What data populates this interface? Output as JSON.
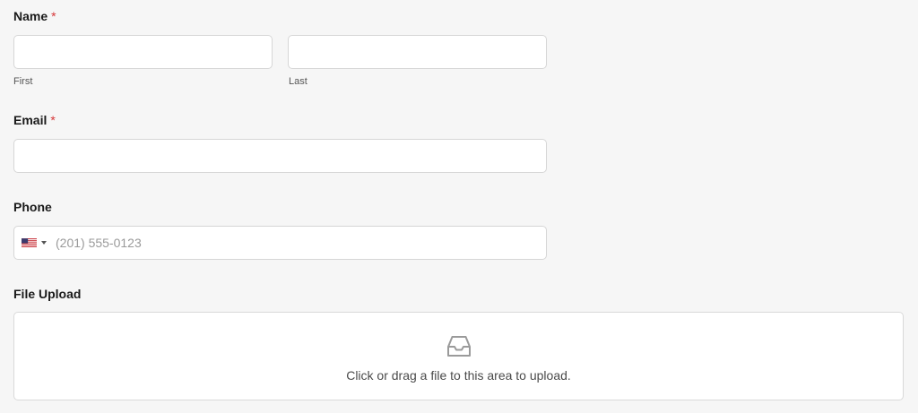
{
  "name": {
    "label": "Name",
    "required_mark": "*",
    "first": {
      "value": "",
      "sublabel": "First"
    },
    "last": {
      "value": "",
      "sublabel": "Last"
    }
  },
  "email": {
    "label": "Email",
    "required_mark": "*",
    "value": ""
  },
  "phone": {
    "label": "Phone",
    "country_icon": "us-flag-icon",
    "placeholder": "(201) 555-0123",
    "value": ""
  },
  "file_upload": {
    "label": "File Upload",
    "icon": "inbox-icon",
    "prompt": "Click or drag a file to this area to upload."
  },
  "colors": {
    "background": "#f6f6f6",
    "required": "#d63638",
    "border": "#d6d6d6"
  }
}
